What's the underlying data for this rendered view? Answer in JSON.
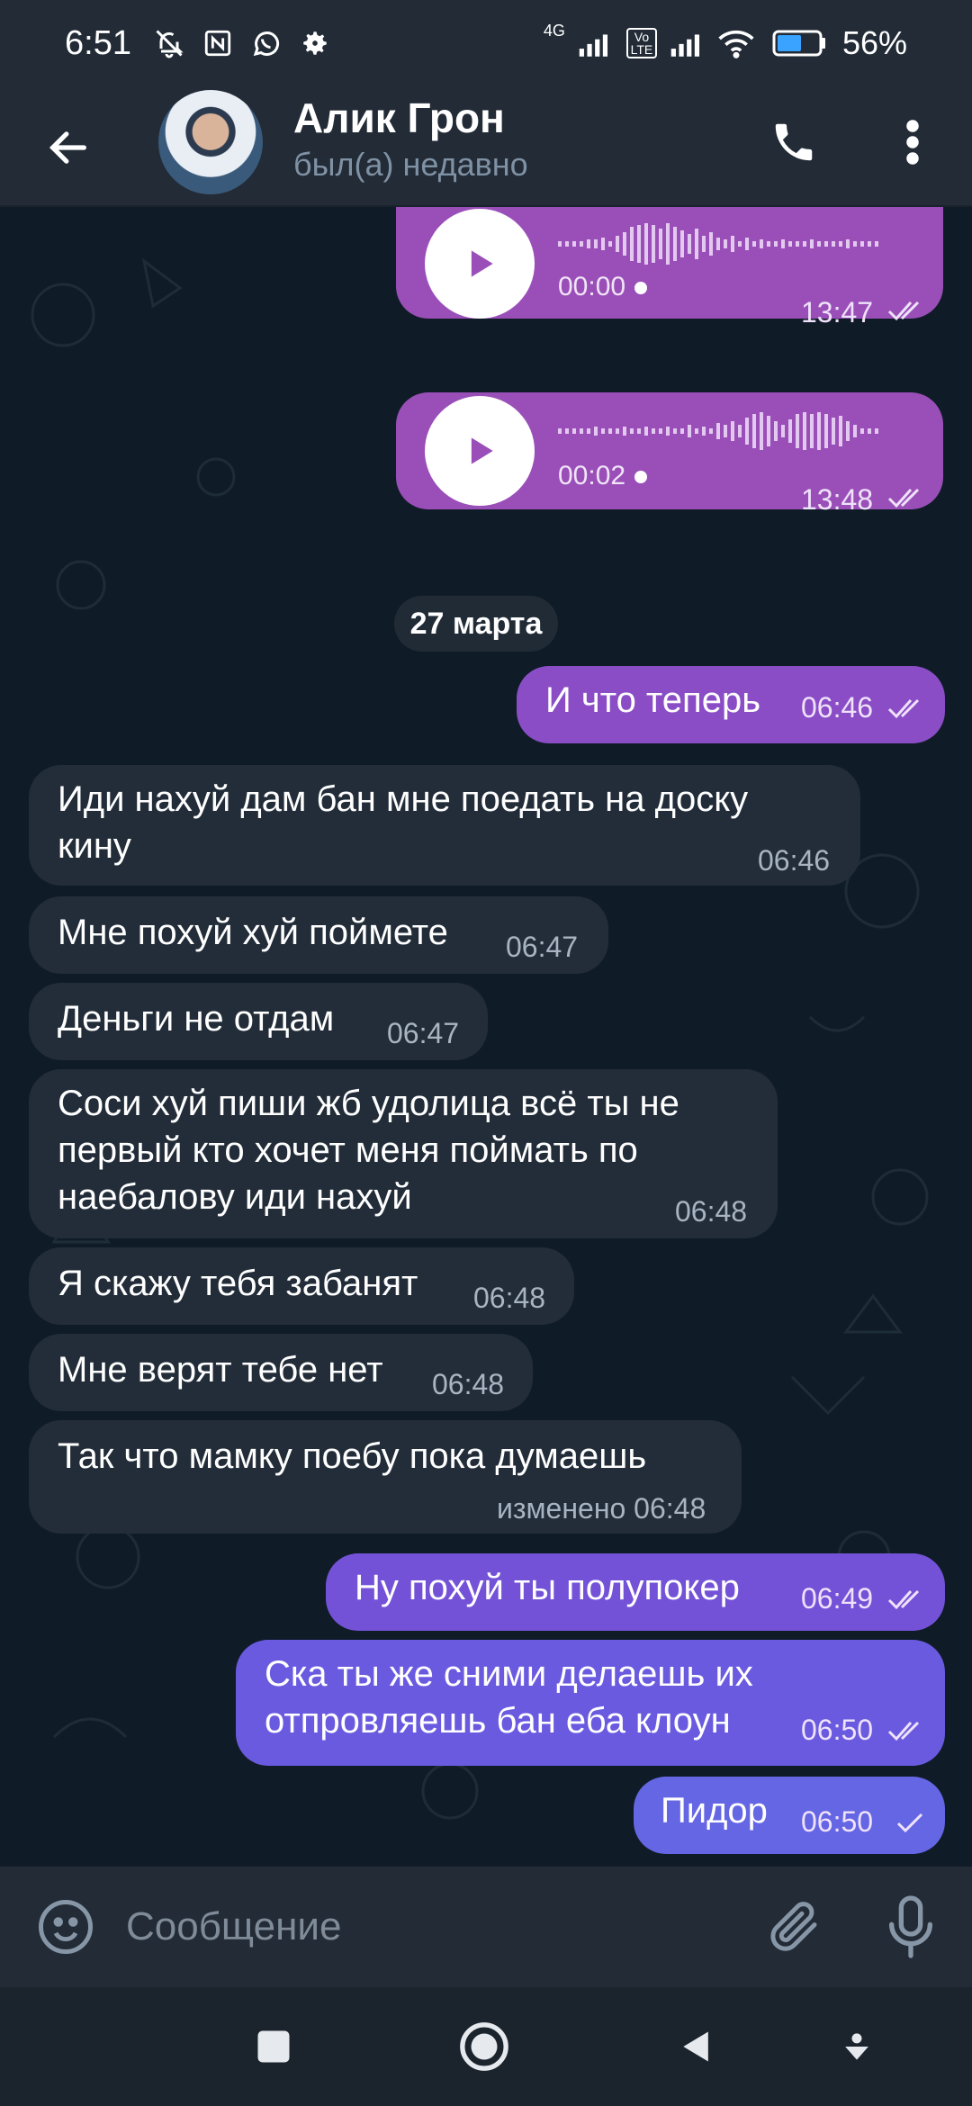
{
  "status_bar": {
    "time": "6:51",
    "network_label": "4G",
    "volte_label": "Vo LTE",
    "battery_percent": "56%",
    "icons": [
      "bell-off-icon",
      "nfc-icon",
      "whatsapp-icon",
      "gear-icon",
      "signal-icon",
      "wifi-icon",
      "battery-icon"
    ]
  },
  "header": {
    "contact_name": "Алик Грон",
    "contact_status": "был(а) недавно",
    "icons": [
      "back-arrow-icon",
      "phone-icon",
      "more-vertical-icon"
    ]
  },
  "chat": {
    "date_separator": "27 марта",
    "voice_messages": [
      {
        "duration": "00:00",
        "time": "13:47",
        "read": true
      },
      {
        "duration": "00:02",
        "time": "13:48",
        "read": true
      }
    ],
    "messages": [
      {
        "direction": "out",
        "text": "И что теперь",
        "time": "06:46",
        "read": true
      },
      {
        "direction": "in",
        "text": "Иди нахуй дам бан мне поедать на доску кину",
        "time": "06:46"
      },
      {
        "direction": "in",
        "text": "Мне похуй хуй поймете",
        "time": "06:47"
      },
      {
        "direction": "in",
        "text": "Деньги не отдам",
        "time": "06:47"
      },
      {
        "direction": "in",
        "text": "Соси хуй пиши жб удолица всё ты не первый кто хочет меня поймать по наебалову иди нахуй",
        "time": "06:48"
      },
      {
        "direction": "in",
        "text": "Я скажу тебя забанят",
        "time": "06:48"
      },
      {
        "direction": "in",
        "text": "Мне верят тебе нет",
        "time": "06:48"
      },
      {
        "direction": "in",
        "text": "Так что мамку поебу пока думаешь",
        "time": "изменено 06:48"
      },
      {
        "direction": "out",
        "text": "Ну похуй ты полупокер",
        "time": "06:49",
        "read": true
      },
      {
        "direction": "out",
        "text": "Ска ты же сними делаешь их отпровляешь бан еба клоун",
        "time": "06:50",
        "read": true
      },
      {
        "direction": "out",
        "text": "Пидор",
        "time": "06:50",
        "read": false
      }
    ],
    "line_breaks": {
      "m1": [
        "Иди нахуй дам бан мне поедать на доску",
        "кину"
      ],
      "m4": [
        "Соси хуй пиши жб удолица всё ты не",
        "первый кто хочет меня поймать по",
        "наебалову иди нахуй"
      ],
      "m9": [
        "Ска ты же сними делаешь их",
        "отпровляешь бан еба клоун"
      ]
    }
  },
  "composer": {
    "placeholder": "Сообщение",
    "icons": [
      "emoji-icon",
      "paperclip-icon",
      "microphone-icon"
    ]
  },
  "navbar": {
    "icons": [
      "recents-square-icon",
      "home-circle-icon",
      "back-triangle-icon",
      "hide-keyboard-icon"
    ]
  },
  "colors": {
    "outgoing_bubble": "#8a4dc6",
    "outgoing_voice_bubble": "#9a4fb8",
    "outgoing_bubble_blue": "#6a5ae0",
    "incoming_bubble": "#222d39",
    "chat_background": "#0f1c27",
    "header_background": "#222b36"
  }
}
